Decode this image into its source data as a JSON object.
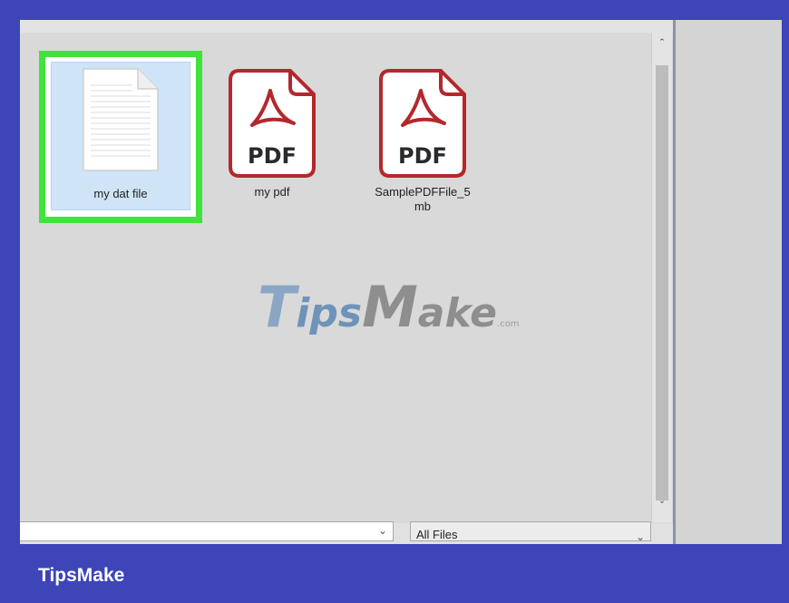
{
  "files": [
    {
      "name": "my dat file",
      "icon": "document-icon",
      "selected": true
    },
    {
      "name": "my pdf",
      "icon": "pdf-icon",
      "badge": "PDF"
    },
    {
      "name": "SamplePDFFile_5\nmb",
      "line1": "SamplePDFFile_5",
      "line2": "mb",
      "icon": "pdf-icon",
      "badge": "PDF"
    }
  ],
  "filename_value": "",
  "file_type_filter": "All Files",
  "watermark": {
    "t": "T",
    "ips": "ips",
    "m": "M",
    "ake": "ake",
    "com": ".com"
  },
  "brand": "TipsMake",
  "colors": {
    "frame": "#3d45b9",
    "highlight": "#3fe43a",
    "selection": "#cfe4f7",
    "pdf_red": "#b3282d"
  }
}
